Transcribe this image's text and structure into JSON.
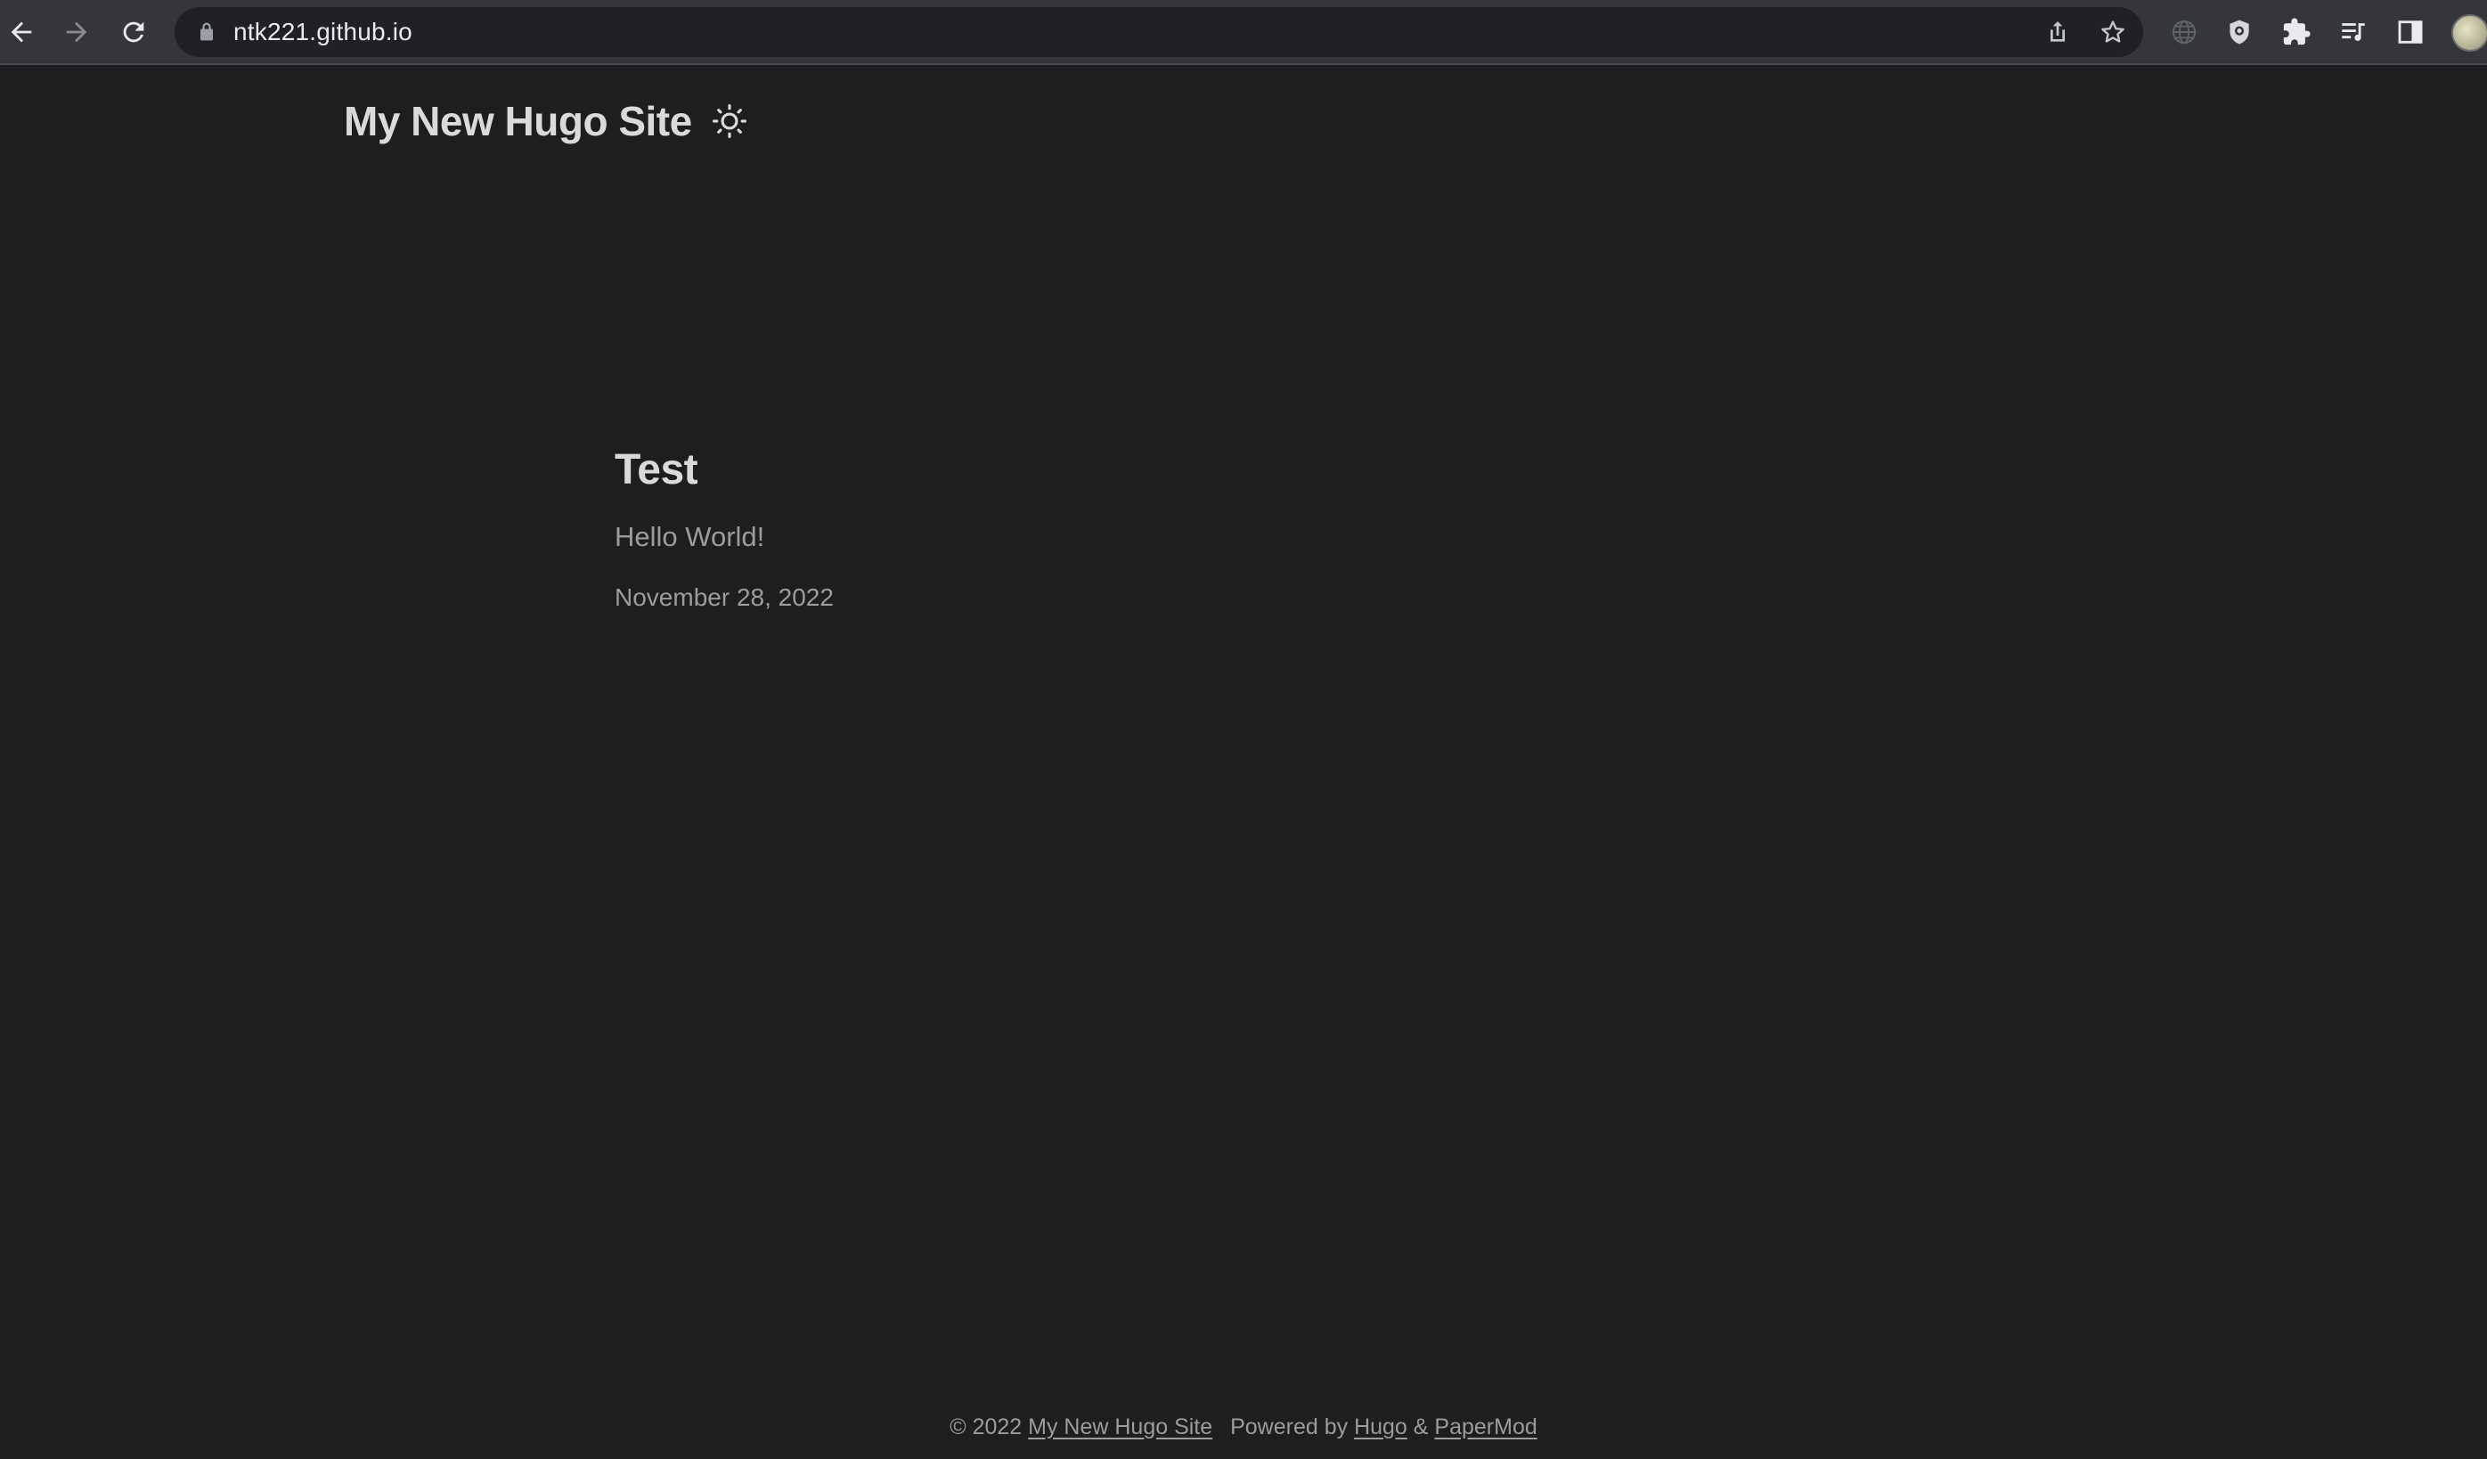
{
  "browser": {
    "url": "ntk221.github.io",
    "icons": {
      "back": "arrow-left-icon",
      "forward": "arrow-right-icon",
      "reload": "reload-icon",
      "lock": "lock-icon",
      "share": "share-icon",
      "bookmark": "star-icon",
      "extensions": [
        "globe-icon",
        "shield-icon",
        "puzzle-icon",
        "media-queue-icon",
        "sidepanel-icon"
      ],
      "profile": "avatar"
    }
  },
  "site": {
    "title": "My New Hugo Site",
    "theme_toggle_icon": "sun-icon"
  },
  "post": {
    "title": "Test",
    "summary": "Hello World!",
    "date": "November 28, 2022"
  },
  "footer": {
    "copyright": "© 2022",
    "site_link": "My New Hugo Site",
    "powered_by": "Powered by",
    "hugo_link": "Hugo",
    "amp": "&",
    "theme_link": "PaperMod"
  },
  "colors": {
    "page_background": "#1d1e20",
    "primary_text": "#dadadb",
    "secondary_text": "#9b9c9d",
    "toolbar": "#35363a",
    "omnibox": "#202124"
  }
}
